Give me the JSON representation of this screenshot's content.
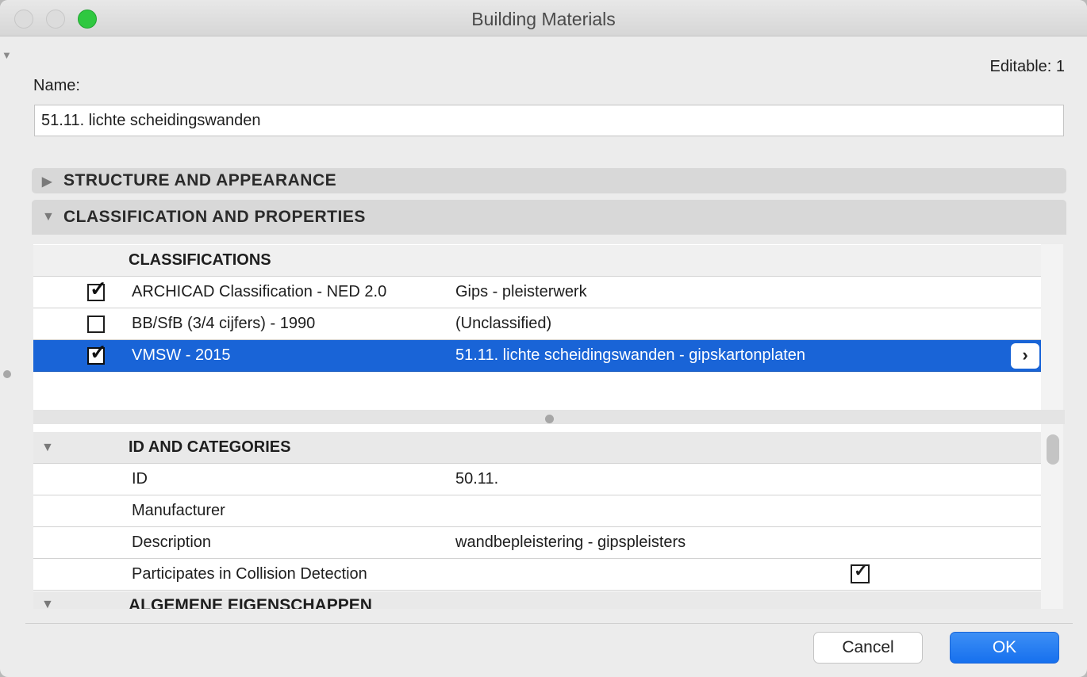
{
  "window": {
    "title": "Building Materials"
  },
  "editable_text": "Editable: 1",
  "name": {
    "label": "Name:",
    "value": "51.11. lichte scheidingswanden"
  },
  "sections": {
    "structure": "STRUCTURE AND APPEARANCE",
    "classification": "CLASSIFICATION AND PROPERTIES"
  },
  "classifications": {
    "header": "CLASSIFICATIONS",
    "rows": [
      {
        "system": "ARCHICAD Classification - NED 2.0",
        "value": "Gips - pleisterwerk",
        "checked": true
      },
      {
        "system": "BB/SfB (3/4 cijfers) - 1990",
        "value": "(Unclassified)",
        "checked": false
      },
      {
        "system": "VMSW - 2015",
        "value": "51.11. lichte scheidingswanden - gipskartonplaten",
        "checked": true
      }
    ],
    "arrow": "›"
  },
  "properties": {
    "group1": "ID AND CATEGORIES",
    "rows": [
      {
        "label": "ID",
        "value": "50.11."
      },
      {
        "label": "Manufacturer",
        "value": ""
      },
      {
        "label": "Description",
        "value": "wandbepleistering - gipspleisters"
      },
      {
        "label": "Participates in Collision Detection",
        "value": "",
        "checked": true
      }
    ],
    "group2": "ALGEMENE EIGENSCHAPPEN"
  },
  "buttons": {
    "cancel": "Cancel",
    "ok": "OK"
  },
  "icons": {
    "checkmark": "✓",
    "triangle_right": "▶",
    "triangle_down": "▼"
  },
  "colors": {
    "selection": "#1964d7",
    "ok_button": "#1670ee",
    "zoom_button": "#2fc840"
  }
}
